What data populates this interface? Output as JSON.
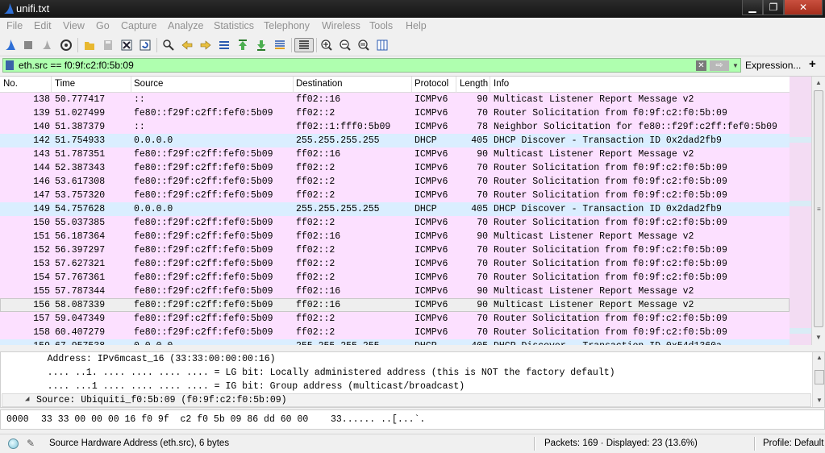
{
  "window": {
    "title": "unifi.txt",
    "minimize": "▁",
    "maximize": "❐",
    "close": "✕"
  },
  "menu": [
    "File",
    "Edit",
    "View",
    "Go",
    "Capture",
    "Analyze",
    "Statistics",
    "Telephony",
    "Wireless",
    "Tools",
    "Help"
  ],
  "filter": {
    "value": "eth.src == f0:9f:c2:f0:5b:09",
    "expression_label": "Expression...",
    "add_label": "+",
    "clear_label": "✕",
    "apply_label": "⇨",
    "dropdown_label": "▼"
  },
  "packet_list": {
    "columns": [
      "No.",
      "Time",
      "Source",
      "Destination",
      "Protocol",
      "Length",
      "Info"
    ],
    "rows": [
      {
        "no": "138",
        "time": "50.777417",
        "src": "::",
        "dst": "ff02::16",
        "proto": "ICMPv6",
        "len": "90",
        "info": "Multicast Listener Report Message v2",
        "kind": "icmp"
      },
      {
        "no": "139",
        "time": "51.027499",
        "src": "fe80::f29f:c2ff:fef0:5b09",
        "dst": "ff02::2",
        "proto": "ICMPv6",
        "len": "70",
        "info": "Router Solicitation from f0:9f:c2:f0:5b:09",
        "kind": "icmp"
      },
      {
        "no": "140",
        "time": "51.387379",
        "src": "::",
        "dst": "ff02::1:fff0:5b09",
        "proto": "ICMPv6",
        "len": "78",
        "info": "Neighbor Solicitation for fe80::f29f:c2ff:fef0:5b09",
        "kind": "icmp"
      },
      {
        "no": "142",
        "time": "51.754933",
        "src": "0.0.0.0",
        "dst": "255.255.255.255",
        "proto": "DHCP",
        "len": "405",
        "info": "DHCP Discover - Transaction ID 0x2dad2fb9",
        "kind": "dhcp"
      },
      {
        "no": "143",
        "time": "51.787351",
        "src": "fe80::f29f:c2ff:fef0:5b09",
        "dst": "ff02::16",
        "proto": "ICMPv6",
        "len": "90",
        "info": "Multicast Listener Report Message v2",
        "kind": "icmp"
      },
      {
        "no": "144",
        "time": "52.387343",
        "src": "fe80::f29f:c2ff:fef0:5b09",
        "dst": "ff02::2",
        "proto": "ICMPv6",
        "len": "70",
        "info": "Router Solicitation from f0:9f:c2:f0:5b:09",
        "kind": "icmp"
      },
      {
        "no": "146",
        "time": "53.617308",
        "src": "fe80::f29f:c2ff:fef0:5b09",
        "dst": "ff02::2",
        "proto": "ICMPv6",
        "len": "70",
        "info": "Router Solicitation from f0:9f:c2:f0:5b:09",
        "kind": "icmp"
      },
      {
        "no": "147",
        "time": "53.757320",
        "src": "fe80::f29f:c2ff:fef0:5b09",
        "dst": "ff02::2",
        "proto": "ICMPv6",
        "len": "70",
        "info": "Router Solicitation from f0:9f:c2:f0:5b:09",
        "kind": "icmp"
      },
      {
        "no": "149",
        "time": "54.757628",
        "src": "0.0.0.0",
        "dst": "255.255.255.255",
        "proto": "DHCP",
        "len": "405",
        "info": "DHCP Discover - Transaction ID 0x2dad2fb9",
        "kind": "dhcp"
      },
      {
        "no": "150",
        "time": "55.037385",
        "src": "fe80::f29f:c2ff:fef0:5b09",
        "dst": "ff02::2",
        "proto": "ICMPv6",
        "len": "70",
        "info": "Router Solicitation from f0:9f:c2:f0:5b:09",
        "kind": "icmp"
      },
      {
        "no": "151",
        "time": "56.187364",
        "src": "fe80::f29f:c2ff:fef0:5b09",
        "dst": "ff02::16",
        "proto": "ICMPv6",
        "len": "90",
        "info": "Multicast Listener Report Message v2",
        "kind": "icmp"
      },
      {
        "no": "152",
        "time": "56.397297",
        "src": "fe80::f29f:c2ff:fef0:5b09",
        "dst": "ff02::2",
        "proto": "ICMPv6",
        "len": "70",
        "info": "Router Solicitation from f0:9f:c2:f0:5b:09",
        "kind": "icmp"
      },
      {
        "no": "153",
        "time": "57.627321",
        "src": "fe80::f29f:c2ff:fef0:5b09",
        "dst": "ff02::2",
        "proto": "ICMPv6",
        "len": "70",
        "info": "Router Solicitation from f0:9f:c2:f0:5b:09",
        "kind": "icmp"
      },
      {
        "no": "154",
        "time": "57.767361",
        "src": "fe80::f29f:c2ff:fef0:5b09",
        "dst": "ff02::2",
        "proto": "ICMPv6",
        "len": "70",
        "info": "Router Solicitation from f0:9f:c2:f0:5b:09",
        "kind": "icmp"
      },
      {
        "no": "155",
        "time": "57.787344",
        "src": "fe80::f29f:c2ff:fef0:5b09",
        "dst": "ff02::16",
        "proto": "ICMPv6",
        "len": "90",
        "info": "Multicast Listener Report Message v2",
        "kind": "icmp"
      },
      {
        "no": "156",
        "time": "58.087339",
        "src": "fe80::f29f:c2ff:fef0:5b09",
        "dst": "ff02::16",
        "proto": "ICMPv6",
        "len": "90",
        "info": "Multicast Listener Report Message v2",
        "kind": "selected"
      },
      {
        "no": "157",
        "time": "59.047349",
        "src": "fe80::f29f:c2ff:fef0:5b09",
        "dst": "ff02::2",
        "proto": "ICMPv6",
        "len": "70",
        "info": "Router Solicitation from f0:9f:c2:f0:5b:09",
        "kind": "icmp"
      },
      {
        "no": "158",
        "time": "60.407279",
        "src": "fe80::f29f:c2ff:fef0:5b09",
        "dst": "ff02::2",
        "proto": "ICMPv6",
        "len": "70",
        "info": "Router Solicitation from f0:9f:c2:f0:5b:09",
        "kind": "icmp"
      },
      {
        "no": "159",
        "time": "67.957538",
        "src": "0.0.0.0",
        "dst": "255.255.255.255",
        "proto": "DHCP",
        "len": "405",
        "info": "DHCP Discover - Transaction ID 0x54d1360a",
        "kind": "dhcp"
      }
    ]
  },
  "details": {
    "line1": "    Address: IPv6mcast_16 (33:33:00:00:00:16)",
    "line2": "    .... ..1. .... .... .... .... = LG bit: Locally administered address (this is NOT the factory default)",
    "line3": "    .... ...1 .... .... .... .... = IG bit: Group address (multicast/broadcast)",
    "selected": "Source: Ubiquiti_f0:5b:09 (f0:9f:c2:f0:5b:09)",
    "expander": "◢"
  },
  "bytes": {
    "offset": "0000",
    "hex": "33 33 00 00 00 16 f0 9f  c2 f0 5b 09 86 dd 60 00",
    "ascii": "33...... ..[...`."
  },
  "status": {
    "field": "Source Hardware Address (eth.src), 6 bytes",
    "packets": "Packets: 169 · Displayed: 23 (13.6%)",
    "profile": "Profile: Default"
  },
  "colors": {
    "icmp_row": "#fce0ff",
    "dhcp_row": "#daeeff",
    "selected_row": "#eeeeee",
    "filter_valid": "#afffaf"
  }
}
